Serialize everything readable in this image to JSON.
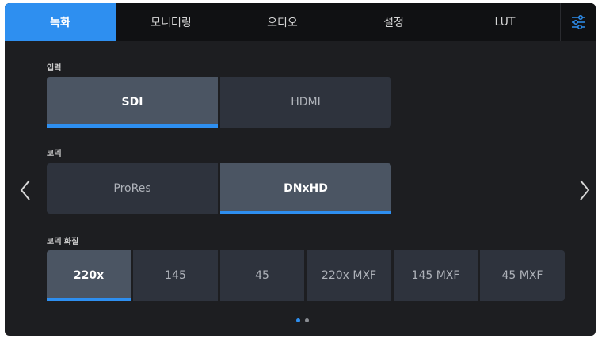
{
  "tabs": [
    {
      "label": "녹화",
      "active": true
    },
    {
      "label": "모니터링",
      "active": false
    },
    {
      "label": "오디오",
      "active": false
    },
    {
      "label": "설정",
      "active": false
    },
    {
      "label": "LUT",
      "active": false
    }
  ],
  "settings_icon": "sliders-icon",
  "input": {
    "label": "입력",
    "options": [
      {
        "label": "SDI",
        "selected": true
      },
      {
        "label": "HDMI",
        "selected": false
      }
    ]
  },
  "codec": {
    "label": "코덱",
    "options": [
      {
        "label": "ProRes",
        "selected": false
      },
      {
        "label": "DNxHD",
        "selected": true
      }
    ]
  },
  "quality": {
    "label": "코덱 화질",
    "options": [
      {
        "label": "220x",
        "selected": true
      },
      {
        "label": "145",
        "selected": false
      },
      {
        "label": "45",
        "selected": false
      },
      {
        "label": "220x MXF",
        "selected": false
      },
      {
        "label": "145 MXF",
        "selected": false
      },
      {
        "label": "45 MXF",
        "selected": false
      }
    ]
  },
  "nav": {
    "prev_icon": "chevron-left-icon",
    "next_icon": "chevron-right-icon"
  },
  "page_indicator": {
    "pages": 2,
    "current": 1
  },
  "colors": {
    "accent": "#2e8ff0",
    "background": "#1d1e21",
    "tabbar": "#101113",
    "button": "#2e333d",
    "button_selected": "#4b5563"
  }
}
